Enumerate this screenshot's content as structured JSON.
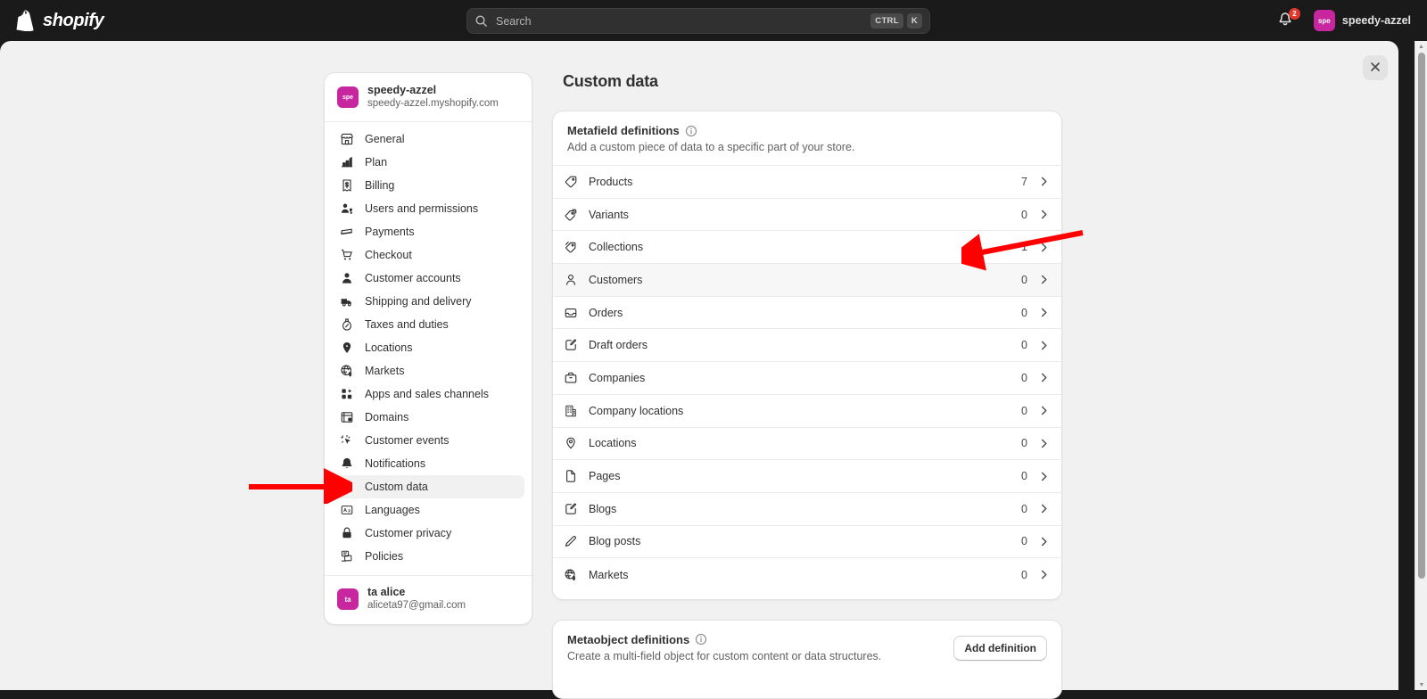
{
  "topbar": {
    "brand": "shopify",
    "brand_icon": "shopify-bag-logo",
    "search": {
      "placeholder": "Search",
      "icon": "search-icon",
      "kbd_ctrl": "CTRL",
      "kbd_key": "K"
    },
    "notifications": {
      "icon": "bell-icon",
      "count": "2"
    },
    "account": {
      "avatar_initials": "spe",
      "name": "speedy-azzel"
    }
  },
  "modal": {
    "close_icon": "close-icon"
  },
  "settings_nav": {
    "store": {
      "avatar_initials": "spe",
      "name": "speedy-azzel",
      "domain": "speedy-azzel.myshopify.com"
    },
    "items": [
      {
        "label": "General",
        "icon": "store-icon",
        "active": false
      },
      {
        "label": "Plan",
        "icon": "chart-bars-icon",
        "active": false
      },
      {
        "label": "Billing",
        "icon": "receipt-dollar-icon",
        "active": false
      },
      {
        "label": "Users and permissions",
        "icon": "person-key-icon",
        "active": false
      },
      {
        "label": "Payments",
        "icon": "credit-cards-icon",
        "active": false
      },
      {
        "label": "Checkout",
        "icon": "shopping-cart-icon",
        "active": false
      },
      {
        "label": "Customer accounts",
        "icon": "person-icon",
        "active": false
      },
      {
        "label": "Shipping and delivery",
        "icon": "delivery-truck-icon",
        "active": false
      },
      {
        "label": "Taxes and duties",
        "icon": "tax-bag-icon",
        "active": false
      },
      {
        "label": "Locations",
        "icon": "map-pin-icon",
        "active": false
      },
      {
        "label": "Markets",
        "icon": "globe-dollar-icon",
        "active": false
      },
      {
        "label": "Apps and sales channels",
        "icon": "apps-grid-icon",
        "active": false
      },
      {
        "label": "Domains",
        "icon": "domain-window-icon",
        "active": false
      },
      {
        "label": "Customer events",
        "icon": "cursor-sparkle-icon",
        "active": false
      },
      {
        "label": "Notifications",
        "icon": "bell-icon",
        "active": false
      },
      {
        "label": "Custom data",
        "icon": "metafields-icon",
        "active": true
      },
      {
        "label": "Languages",
        "icon": "translate-icon",
        "active": false
      },
      {
        "label": "Customer privacy",
        "icon": "lock-icon",
        "active": false
      },
      {
        "label": "Policies",
        "icon": "policies-icon",
        "active": false
      }
    ],
    "user": {
      "avatar_initials": "ta",
      "name": "ta alice",
      "email": "aliceta97@gmail.com"
    }
  },
  "main": {
    "page_title": "Custom data",
    "metafield_card": {
      "title": "Metafield definitions",
      "info_icon": "info-circle-icon",
      "subtitle": "Add a custom piece of data to a specific part of your store.",
      "chevron_icon": "chevron-right-icon",
      "rows": [
        {
          "label": "Products",
          "icon": "tag-icon",
          "count": "7",
          "hovered": false
        },
        {
          "label": "Variants",
          "icon": "tags-stack-icon",
          "count": "0",
          "hovered": false
        },
        {
          "label": "Collections",
          "icon": "collection-tag-icon",
          "count": "1",
          "hovered": false
        },
        {
          "label": "Customers",
          "icon": "person-icon",
          "count": "0",
          "hovered": true
        },
        {
          "label": "Orders",
          "icon": "order-tray-icon",
          "count": "0",
          "hovered": false
        },
        {
          "label": "Draft orders",
          "icon": "draft-order-icon",
          "count": "0",
          "hovered": false
        },
        {
          "label": "Companies",
          "icon": "briefcase-icon",
          "count": "0",
          "hovered": false
        },
        {
          "label": "Company locations",
          "icon": "building-icon",
          "count": "0",
          "hovered": false
        },
        {
          "label": "Locations",
          "icon": "map-pin-icon",
          "count": "0",
          "hovered": false
        },
        {
          "label": "Pages",
          "icon": "page-icon",
          "count": "0",
          "hovered": false
        },
        {
          "label": "Blogs",
          "icon": "blog-edit-icon",
          "count": "0",
          "hovered": false
        },
        {
          "label": "Blog posts",
          "icon": "pencil-icon",
          "count": "0",
          "hovered": false
        },
        {
          "label": "Markets",
          "icon": "globe-dollar-icon",
          "count": "0",
          "hovered": false
        }
      ]
    },
    "metaobject_card": {
      "title": "Metaobject definitions",
      "info_icon": "info-circle-icon",
      "subtitle": "Create a multi-field object for custom content or data structures.",
      "add_button": "Add definition"
    }
  },
  "annotations": {
    "accent_color": "#ff0000",
    "arrow_sidebar": "arrow-pointing-to-custom-data",
    "arrow_collections": "arrow-pointing-to-collections-count"
  }
}
